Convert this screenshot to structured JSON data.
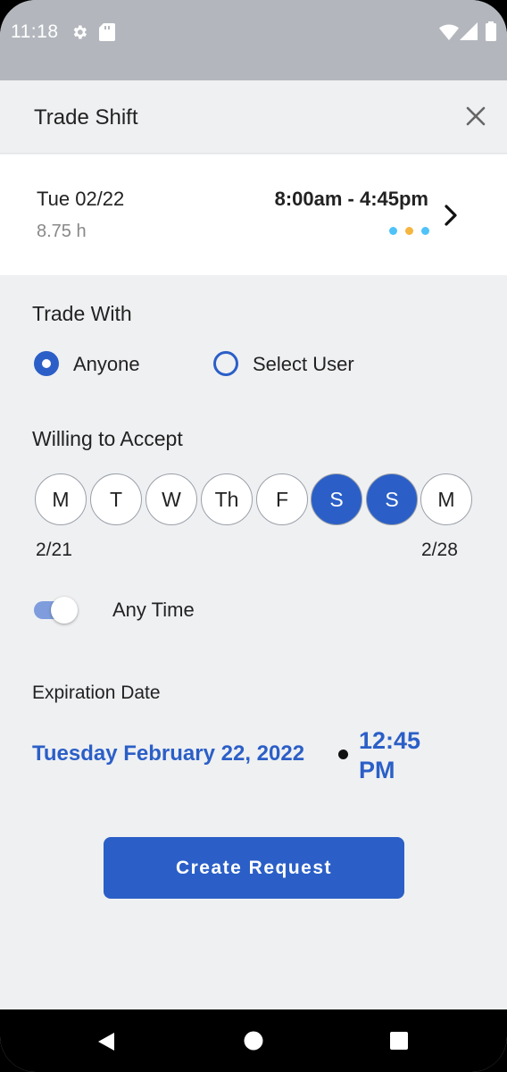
{
  "status_bar": {
    "time": "11:18",
    "icons": [
      "gear-icon",
      "sd-card-icon",
      "wifi-icon",
      "signal-icon",
      "battery-icon"
    ]
  },
  "header": {
    "title": "Trade Shift",
    "close_icon": "close-icon"
  },
  "shift": {
    "date": "Tue 02/22",
    "hours": "8.75 h",
    "time_range": "8:00am - 4:45pm",
    "dot_colors": [
      "#4fc3f7",
      "#f4b63f",
      "#4fc3f7"
    ]
  },
  "trade_with": {
    "label": "Trade With",
    "options": [
      {
        "label": "Anyone",
        "checked": true
      },
      {
        "label": "Select User",
        "checked": false
      }
    ]
  },
  "willing": {
    "label": "Willing to Accept",
    "days": [
      {
        "label": "M",
        "selected": false
      },
      {
        "label": "T",
        "selected": false
      },
      {
        "label": "W",
        "selected": false
      },
      {
        "label": "Th",
        "selected": false
      },
      {
        "label": "F",
        "selected": false
      },
      {
        "label": "S",
        "selected": true
      },
      {
        "label": "S",
        "selected": true
      },
      {
        "label": "M",
        "selected": false
      }
    ],
    "start_date": "2/21",
    "end_date": "2/28"
  },
  "any_time": {
    "label": "Any Time",
    "on": true
  },
  "expiration": {
    "label": "Expiration Date",
    "date": "Tuesday February 22, 2022",
    "time": "12:45 PM"
  },
  "actions": {
    "create_label": "Create Request"
  },
  "colors": {
    "primary": "#2b5fc7",
    "background": "#eff0f2",
    "status_bar": "#b3b7bd"
  }
}
